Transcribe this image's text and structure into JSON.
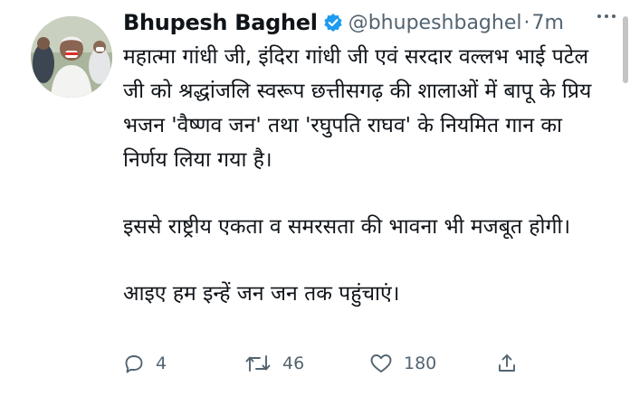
{
  "tweet": {
    "author_name": "Bhupesh Baghel",
    "handle": "@bhupeshbaghel",
    "separator": "·",
    "time": "7m",
    "paragraphs": [
      "महात्मा गांधी जी, इंदिरा गांधी जी एवं सरदार वल्लभ भाई पटेल जी को श्रद्धांजलि स्वरूप छत्तीसगढ़ की शालाओं में बापू के प्रिय भजन 'वैष्णव जन' तथा 'रघुपति राघव' के नियमित गान का निर्णय लिया गया है।",
      "इससे राष्ट्रीय एकता व समरसता की भावना भी मजबूत होगी।",
      "आइए हम इन्हें जन जन तक पहुंचाएं।"
    ]
  },
  "actions": {
    "reply_count": "4",
    "retweet_count": "46",
    "like_count": "180"
  },
  "icons": {
    "verified": "verified-badge-icon",
    "more": "more-options-icon",
    "reply": "reply-icon",
    "retweet": "retweet-icon",
    "like": "like-icon",
    "share": "share-icon"
  },
  "colors": {
    "verified_blue": "#1d9bf0",
    "text": "#0f1419",
    "secondary": "#536471"
  }
}
